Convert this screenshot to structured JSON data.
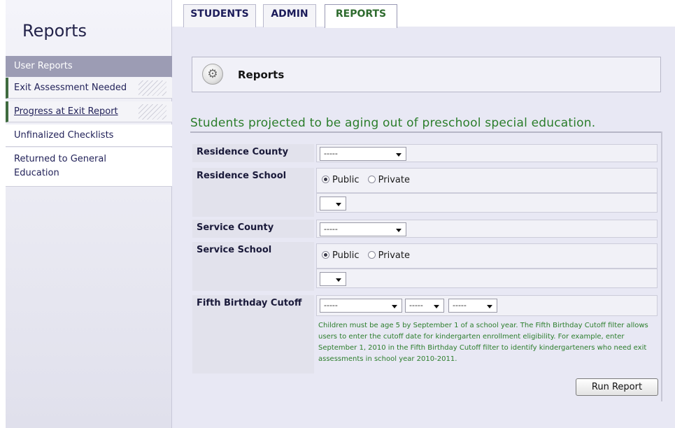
{
  "sidebar": {
    "title": "Reports",
    "section": "User Reports",
    "items": [
      {
        "label": "Exit Assessment Needed"
      },
      {
        "label": "Progress at Exit Report"
      },
      {
        "label": "Unfinalized Checklists"
      },
      {
        "label": "Returned to General Education"
      }
    ]
  },
  "tabs": [
    {
      "label": "STUDENTS"
    },
    {
      "label": "ADMIN"
    },
    {
      "label": "REPORTS"
    }
  ],
  "reports_box": {
    "title": "Reports",
    "icon": "gear-icon"
  },
  "subtitle": "Students projected to be aging out of preschool special education.",
  "form": {
    "residence_county": {
      "label": "Residence County",
      "value": "-----"
    },
    "residence_school": {
      "label": "Residence School",
      "public": "Public",
      "private": "Private",
      "selected": "Public"
    },
    "service_county": {
      "label": "Service County",
      "value": "-----"
    },
    "service_school": {
      "label": "Service School",
      "public": "Public",
      "private": "Private",
      "selected": "Public"
    },
    "fifth_birthday_cutoff": {
      "label": "Fifth Birthday Cutoff",
      "month": "-----",
      "day": "-----",
      "year": "-----",
      "help": "Children must be age 5 by September 1 of a school year. The Fifth Birthday Cutoff filter allows users to enter the cutoff date for kindergarten enrollment eligibility. For example, enter September 1, 2010 in the Fifth Birthday Cutoff filter to identify kindergarteners who need exit assessments in school year 2010-2011."
    },
    "run_button": "Run Report"
  },
  "colors": {
    "accent_green": "#2b7d2b",
    "sidebar_section": "#9c9cb4",
    "content_bg": "#e8e8f4"
  }
}
